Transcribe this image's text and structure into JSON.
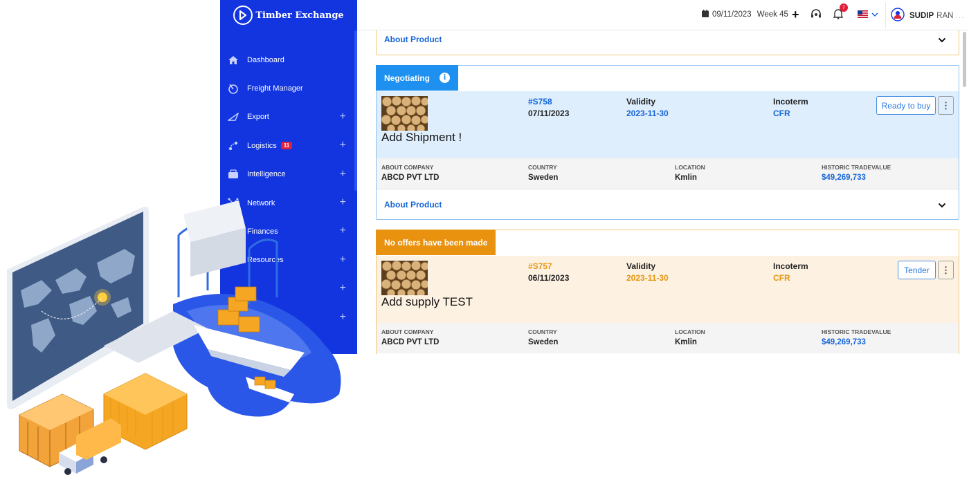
{
  "app": {
    "name": "Timber Exchange"
  },
  "sidebar": {
    "items": [
      {
        "label": "Dashboard",
        "icon": "home-icon",
        "expandable": false
      },
      {
        "label": "Freight Manager",
        "icon": "freight-icon",
        "expandable": false
      },
      {
        "label": "Export",
        "icon": "export-icon",
        "expandable": true
      },
      {
        "label": "Logistics",
        "icon": "logistics-icon",
        "expandable": true,
        "badge": "11"
      },
      {
        "label": "Intelligence",
        "icon": "intelligence-icon",
        "expandable": true
      },
      {
        "label": "Network",
        "icon": "network-icon",
        "expandable": true
      },
      {
        "label": "Finances",
        "icon": "finances-icon",
        "expandable": true
      },
      {
        "label": "Resources",
        "icon": "resources-icon",
        "expandable": true
      },
      {
        "label": "",
        "icon": "",
        "expandable": true
      },
      {
        "label": "",
        "icon": "",
        "expandable": true
      }
    ]
  },
  "topbar": {
    "date": "09/11/2023",
    "week": "Week 45",
    "notifications": "7",
    "language": "US",
    "user_first": "SUDIP",
    "user_last": "RAN",
    "more": "..."
  },
  "about_label": "About Product",
  "offers": [
    {
      "status": "Negotiating",
      "status_color": "#1e90f0",
      "card_border": "#8ec1ef",
      "body_bg": "#deeefd",
      "accent": "#1565d8",
      "id": "#S758",
      "date": "07/11/2023",
      "validity_label": "Validity",
      "validity": "2023-11-30",
      "incoterm_label": "Incoterm",
      "incoterm": "CFR",
      "title": "Add Shipment !",
      "action": "Ready to buy",
      "company_label": "ABOUT COMPANY",
      "company": "ABCD PVT LTD",
      "country_label": "COUNTRY",
      "country": "Sweden",
      "location_label": "LOCATION",
      "location": "Kmlin",
      "trade_label": "HISTORIC TRADEVALUE",
      "trade_value": "$49,269,733"
    },
    {
      "status": "No offers have been made",
      "status_color": "#e8920f",
      "card_border": "#f3c77a",
      "body_bg": "#fdf1e2",
      "accent": "#e69810",
      "id": "#S757",
      "date": "06/11/2023",
      "validity_label": "Validity",
      "validity": "2023-11-30",
      "incoterm_label": "Incoterm",
      "incoterm": "CFR",
      "title": "Add supply TEST",
      "action": "Tender",
      "company_label": "ABOUT COMPANY",
      "company": "ABCD PVT LTD",
      "country_label": "COUNTRY",
      "country": "Sweden",
      "location_label": "LOCATION",
      "location": "Kmlin",
      "trade_label": "HISTORIC TRADEVALUE",
      "trade_value": "$49,269,733"
    }
  ]
}
